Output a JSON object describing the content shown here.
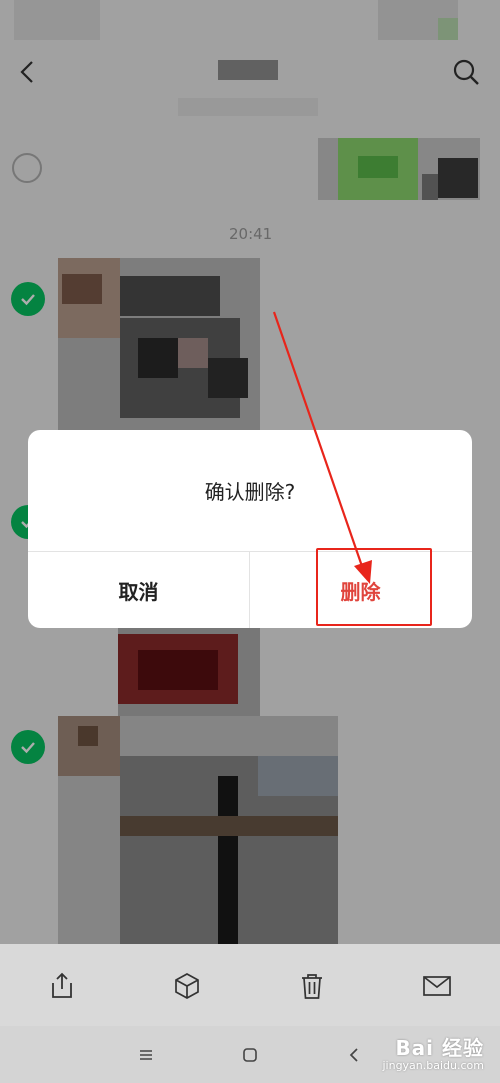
{
  "header": {
    "back_icon": "chevron-left-icon",
    "search_icon": "search-icon"
  },
  "chat": {
    "timestamp": "20:41"
  },
  "dialog": {
    "title": "确认删除?",
    "cancel_label": "取消",
    "delete_label": "删除"
  },
  "toolbar": {
    "items": [
      "share-icon",
      "box-icon",
      "trash-icon",
      "mail-icon"
    ]
  },
  "system_nav": {
    "items": [
      "menu-icon",
      "home-icon",
      "back-icon"
    ]
  },
  "watermark": {
    "main": "Bai 经验",
    "sub": "jingyan.baidu.com"
  },
  "colors": {
    "accent_green": "#07c160",
    "delete_red": "#e0453d",
    "annotation_red": "#e8251b"
  }
}
